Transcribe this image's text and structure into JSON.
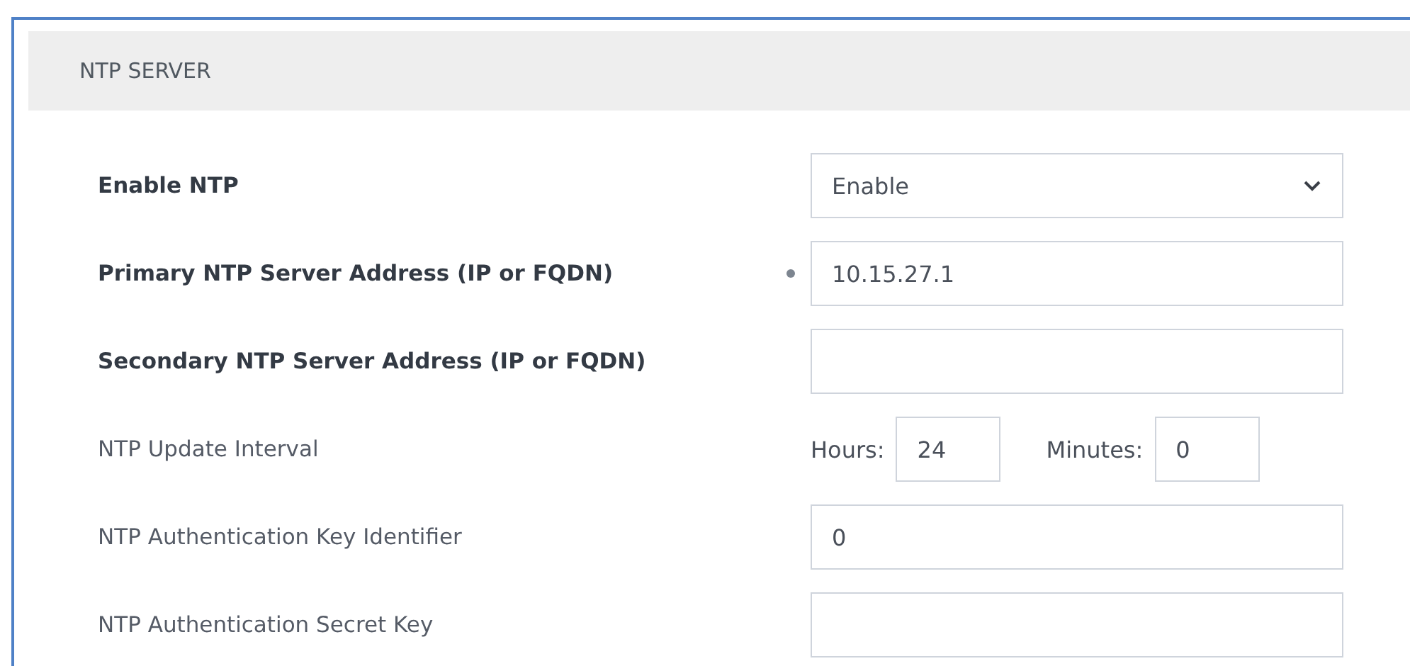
{
  "section": {
    "title": "NTP SERVER"
  },
  "rows": [
    {
      "kind": "select",
      "label": "Enable NTP",
      "modified": true,
      "marked": false,
      "value": "Enable"
    },
    {
      "kind": "text",
      "label": "Primary NTP Server Address (IP or FQDN)",
      "modified": true,
      "marked": true,
      "value": "10.15.27.1"
    },
    {
      "kind": "text",
      "label": "Secondary NTP Server Address (IP or FQDN)",
      "modified": true,
      "marked": false,
      "value": ""
    },
    {
      "kind": "interval",
      "label": "NTP Update Interval",
      "modified": false,
      "marked": false,
      "hours_label": "Hours:",
      "hours": "24",
      "minutes_label": "Minutes:",
      "minutes": "0"
    },
    {
      "kind": "text",
      "label": "NTP Authentication Key Identifier",
      "modified": false,
      "marked": false,
      "value": "0"
    },
    {
      "kind": "text",
      "label": "NTP Authentication Secret Key",
      "modified": false,
      "marked": false,
      "value": ""
    }
  ]
}
